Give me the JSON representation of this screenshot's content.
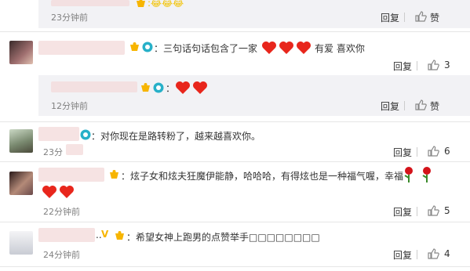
{
  "comments": [
    {
      "time": "23分钟前",
      "reply": "回复",
      "like": "赞",
      "like_count": ""
    },
    {
      "text": "：三句话句话包含了一家",
      "suffix": "有爱 喜欢你",
      "reply": "回复",
      "like_count": "3"
    },
    {
      "time": "12分钟前",
      "reply": "回复",
      "like": "赞"
    },
    {
      "text": "：对你现在是路转粉了，越来越喜欢你。",
      "time": "23分",
      "reply": "回复",
      "like_count": "6"
    },
    {
      "text_line1": "：炫子女和炫夫狂魔伊能静，哈哈哈，有得炫也是一种福气喔，幸福",
      "time": "22分钟前",
      "reply": "回复",
      "like_count": "5"
    },
    {
      "text": "：希望女神上跑男的点赞举手□□□□□□□□",
      "time": "24分钟前",
      "reply": "回复",
      "like_count": "4"
    }
  ],
  "icons": {
    "thumb": "thumbs-up-icon",
    "heart": "heart-icon",
    "rose": "rose-icon",
    "vip": "vip-badge-icon",
    "camera": "camera-badge-icon"
  }
}
